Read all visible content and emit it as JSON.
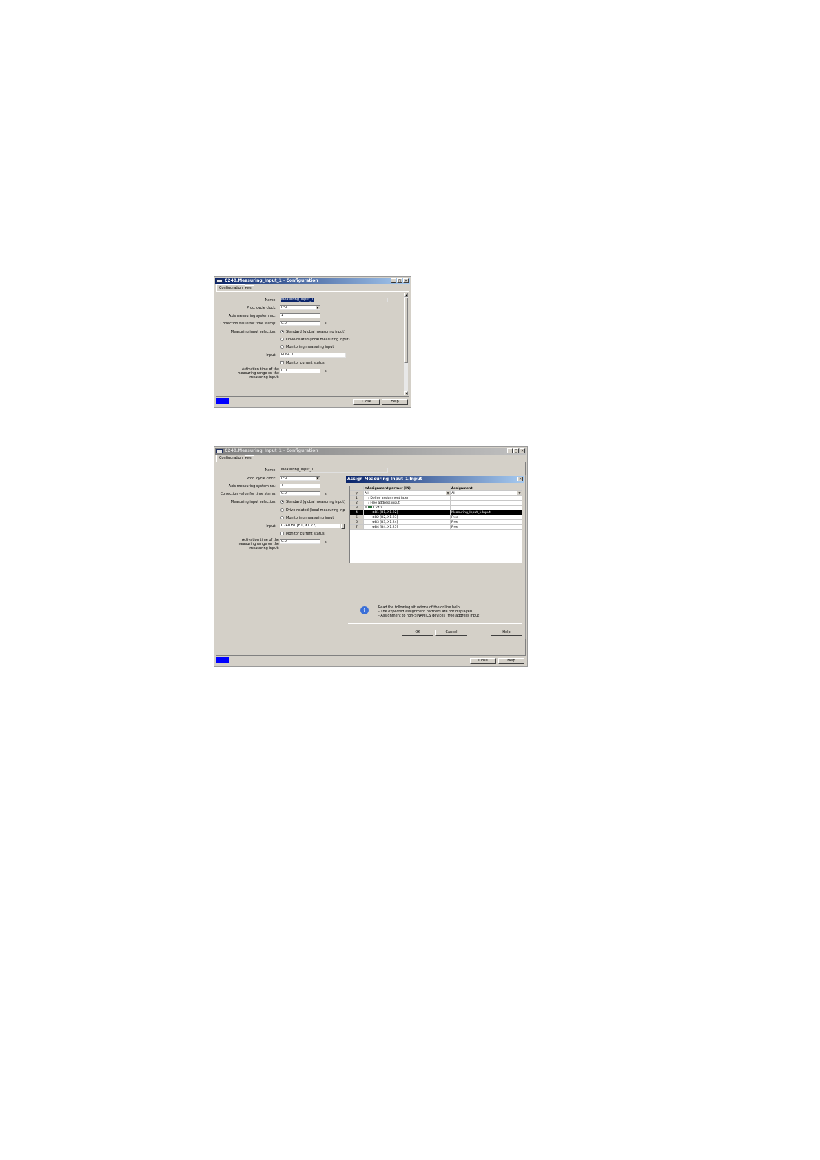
{
  "dialog1": {
    "title": "C240.Measuring_Input_1 - Configuration",
    "tabs": [
      "Configuration",
      "Units"
    ],
    "labels": {
      "name": "Name:",
      "proc_cycle": "Proc. cycle clock:",
      "axis_meas": "Axis measuring system no.:",
      "correction": "Correction value for time stamp:",
      "selection": "Measuring input selection:",
      "input": "Input:",
      "activation": "Activation time of the measuring range on the measuring input:"
    },
    "values": {
      "name": "Measuring_Input_1",
      "proc_cycle": "IPO",
      "axis_meas": "1",
      "correction": "0.0",
      "input": "PI 64.0",
      "activation": "0.0"
    },
    "units": {
      "correction": "s",
      "activation": "s"
    },
    "radios": [
      "Standard (global measuring input)",
      "Drive-related (local measuring input)",
      "Monitoring measuring input"
    ],
    "monitor_label": "Monitor current status",
    "buttons": {
      "close": "Close",
      "help": "Help"
    }
  },
  "dialog2": {
    "title": "C240.Measuring_Input_1 - Configuration",
    "tabs": [
      "Configuration",
      "Units"
    ],
    "labels": {
      "name": "Name:",
      "proc_cycle": "Proc. cycle clock:",
      "axis_meas": "Axis measuring system no.:",
      "correction": "Correction value for time stamp:",
      "selection": "Measuring input selection:",
      "input": "Input:",
      "activation": "Activation time of the measuring range on the measuring input:"
    },
    "values": {
      "name": "Measuring_Input_1",
      "proc_cycle": "IPO",
      "axis_meas": "1",
      "correction": "0.0",
      "input": "C240.B1 [B1, X1.22]",
      "activation": "0.0"
    },
    "units": {
      "correction": "s",
      "activation": "s"
    },
    "radios": [
      "Standard (global measuring input)",
      "Drive-related (local measuring input)",
      "Monitoring measuring input"
    ],
    "monitor_label": "Monitor current status",
    "buttons": {
      "close": "Close",
      "help": "Help"
    }
  },
  "assign": {
    "title": "Assign Measuring_Input_1.Input",
    "columns": [
      "Assignment partner (IN)",
      "Assignment"
    ],
    "filters": [
      "All",
      "All"
    ],
    "rows": [
      {
        "num": "1",
        "partner": "Define assignment later",
        "assignment": ""
      },
      {
        "num": "2",
        "partner": "Free address input",
        "assignment": ""
      },
      {
        "num": "3",
        "partner": "C240",
        "assignment": ""
      },
      {
        "num": "4",
        "partner": "B1 [B1, X1.22]",
        "assignment": "Measuring_Input_1.Input"
      },
      {
        "num": "5",
        "partner": "B2 [B2, X1.23]",
        "assignment": "Free"
      },
      {
        "num": "6",
        "partner": "B3 [B3, X1.24]",
        "assignment": "Free"
      },
      {
        "num": "7",
        "partner": "B4 [B4, X1.25]",
        "assignment": "Free"
      }
    ],
    "info": [
      "Read the following situations of the online help:",
      "- The expected assignment partners are not displayed.",
      "- Assignment to non-SINAMICS devices (free address input)"
    ],
    "buttons": {
      "ok": "OK",
      "cancel": "Cancel",
      "help": "Help"
    }
  }
}
